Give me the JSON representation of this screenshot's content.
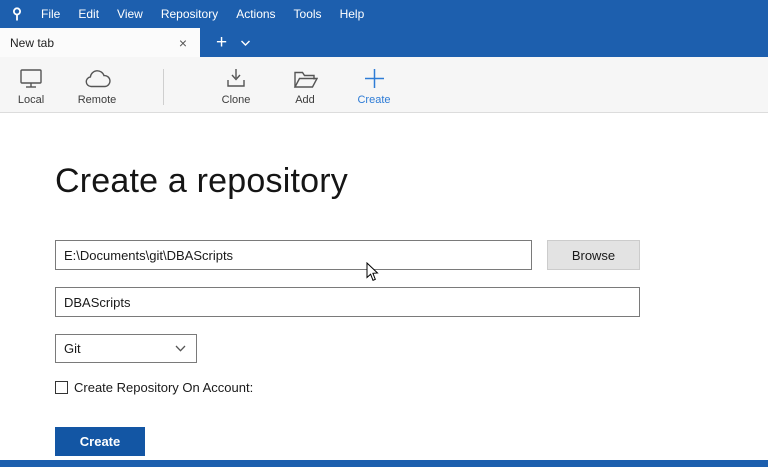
{
  "titlebar": {
    "menus": [
      "File",
      "Edit",
      "View",
      "Repository",
      "Actions",
      "Tools",
      "Help"
    ]
  },
  "tabbar": {
    "tab_label": "New tab",
    "close_glyph": "×",
    "new_tab_glyph": "+"
  },
  "toolbar": {
    "items": [
      {
        "label": "Local",
        "icon": "monitor-icon"
      },
      {
        "label": "Remote",
        "icon": "cloud-icon"
      },
      {
        "label": "Clone",
        "icon": "download-icon"
      },
      {
        "label": "Add",
        "icon": "folder-icon"
      },
      {
        "label": "Create",
        "icon": "plus-icon",
        "active": true
      }
    ]
  },
  "main": {
    "heading": "Create a repository",
    "path_value": "E:\\Documents\\git\\DBAScripts",
    "browse_label": "Browse",
    "name_value": "DBAScripts",
    "vcs_value": "Git",
    "account_checkbox_label": "Create Repository On Account:",
    "create_label": "Create"
  },
  "colors": {
    "titlebar_blue": "#1d5fae",
    "accent_blue": "#2e7cd6",
    "button_blue": "#1356a4"
  }
}
